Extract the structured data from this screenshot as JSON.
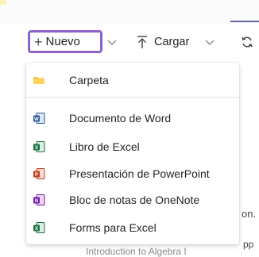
{
  "toolbar": {
    "new_label": "Nuevo",
    "upload_label": "Cargar"
  },
  "new_menu": {
    "items": [
      {
        "label": "Carpeta",
        "icon": "folder-icon",
        "color": "#f5c343"
      },
      {
        "label": "Documento de Word",
        "icon": "word-icon",
        "color": "#2b579a"
      },
      {
        "label": "Libro de Excel",
        "icon": "excel-icon",
        "color": "#217346"
      },
      {
        "label": "Presentación de PowerPoint",
        "icon": "powerpoint-icon",
        "color": "#c43e1c"
      },
      {
        "label": "Bloc de notas de OneNote",
        "icon": "onenote-icon",
        "color": "#7719aa"
      },
      {
        "label": "Forms para Excel",
        "icon": "forms-excel-icon",
        "color": "#217346"
      }
    ]
  },
  "background": {
    "fragment_right": "on.",
    "fragment_bottom": "Introduction to Algebra I",
    "fragment_bottom_right": "pp"
  },
  "colors": {
    "accent_outline": "#8b63c9",
    "teams_purple": "#6264a7"
  }
}
